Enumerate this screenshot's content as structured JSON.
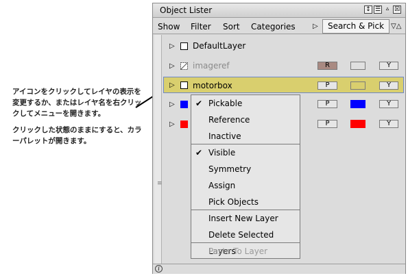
{
  "annotation": {
    "line1": "アイコンをクリックしてレイヤの表示を変更するか、またはレイヤ名を右クリックしてメニューを開きます。",
    "line2": "クリックした状態のままにすると、カラーパレットが開きます。"
  },
  "window": {
    "title": "Object Lister",
    "title_buttons": [
      "↕",
      "☰",
      "▵",
      "☒"
    ]
  },
  "menubar": {
    "show": "Show",
    "filter": "Filter",
    "sort": "Sort",
    "categories": "Categories",
    "arrow": "▷",
    "search_pick": "Search & Pick",
    "collapse": "▽△"
  },
  "layers": [
    {
      "name": "DefaultLayer",
      "dim": false,
      "icon": "empty-square",
      "selected": false,
      "c1": "",
      "c2": "",
      "c3": ""
    },
    {
      "name": "imageref",
      "dim": true,
      "icon": "slashed-square",
      "selected": false,
      "c1": "R",
      "c2": "",
      "c3": "Y",
      "c1_color": "#a98a82",
      "c2_color": "#e0e0e0"
    },
    {
      "name": "motorbox",
      "dim": false,
      "icon": "empty-square",
      "selected": true,
      "c1": "P",
      "c2": "",
      "c3": "Y",
      "c1_color": "#e6e6e6",
      "c2_color": "#d9cf6e"
    },
    {
      "name": "",
      "dim": false,
      "icon": "blue-square",
      "selected": false,
      "c1": "P",
      "c2": "",
      "c3": "Y",
      "swatch_color": "#0000ff",
      "c1_color": "#e6e6e6",
      "c2_color": "#0000ff"
    },
    {
      "name": "",
      "dim": false,
      "icon": "red-square",
      "selected": false,
      "c1": "P",
      "c2": "",
      "c3": "Y",
      "swatch_color": "#ff0000",
      "c1_color": "#e6e6e6",
      "c2_color": "#ff0000"
    }
  ],
  "context_menu": {
    "items": [
      {
        "label": "Pickable",
        "checked": true,
        "disabled": false
      },
      {
        "label": "Reference",
        "checked": false,
        "disabled": false
      },
      {
        "label": "Inactive",
        "checked": false,
        "disabled": false
      },
      {
        "label": "Visible",
        "checked": true,
        "disabled": false
      },
      {
        "label": "Symmetry",
        "checked": false,
        "disabled": false
      },
      {
        "label": "Assign",
        "checked": false,
        "disabled": false
      },
      {
        "label": "Pick Objects",
        "checked": false,
        "disabled": false
      },
      {
        "label": "Insert New Layer",
        "checked": false,
        "disabled": false
      },
      {
        "label": "Delete Selected Layers",
        "checked": false,
        "disabled": false
      },
      {
        "label": "Paste To Layer",
        "checked": false,
        "disabled": true
      }
    ],
    "check_glyph": "✔"
  },
  "status": {
    "info_glyph": "i"
  },
  "colors": {
    "selection": "#d9cf6e",
    "selection_border": "#6d87c6",
    "window_bg": "#dcdcdc"
  }
}
